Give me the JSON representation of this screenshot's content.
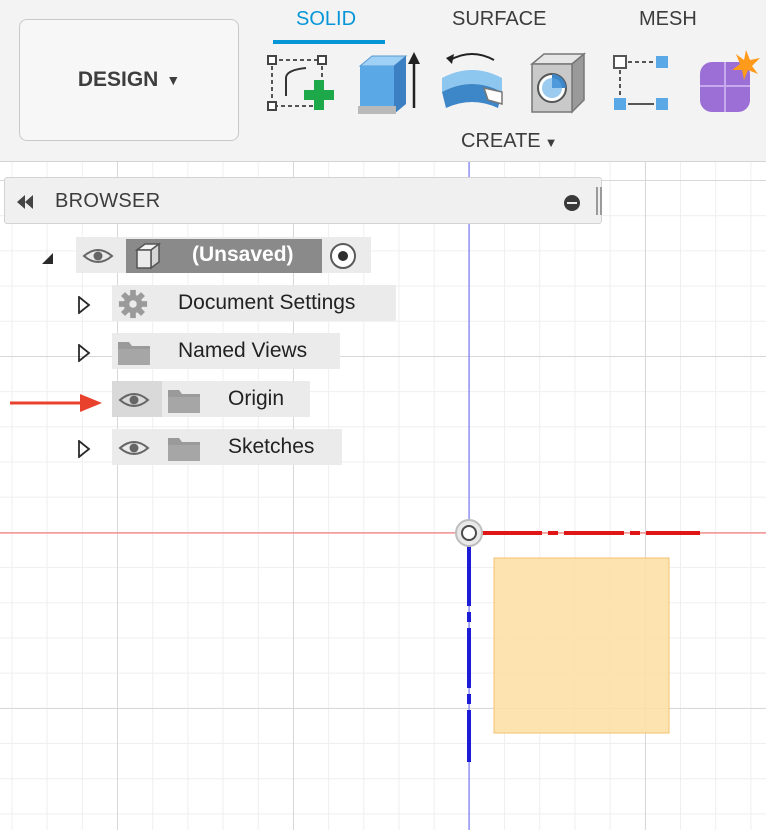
{
  "toolbar": {
    "workspace": "DESIGN",
    "tabs": [
      "SOLID",
      "SURFACE",
      "MESH"
    ],
    "active_tab": "SOLID",
    "create_label": "CREATE",
    "tools": [
      "create-sketch-icon",
      "extrude-icon",
      "revolve-icon",
      "hole-icon",
      "pattern-icon",
      "form-icon"
    ],
    "accent_color": "#0696d7"
  },
  "browser": {
    "title": "BROWSER",
    "root": {
      "label": "(Unsaved)"
    },
    "items": [
      {
        "label": "Document Settings",
        "icon": "gear-icon"
      },
      {
        "label": "Named Views",
        "icon": "folder-icon"
      },
      {
        "label": "Origin",
        "icon": "folder-icon"
      },
      {
        "label": "Sketches",
        "icon": "folder-icon"
      }
    ]
  },
  "annotation": {
    "arrow_color": "#e8412c"
  },
  "axes": {
    "x_axis_color": "#ff0000",
    "y_axis_color": "#0000ff"
  },
  "sketch_profile_color": "#fde0a6"
}
